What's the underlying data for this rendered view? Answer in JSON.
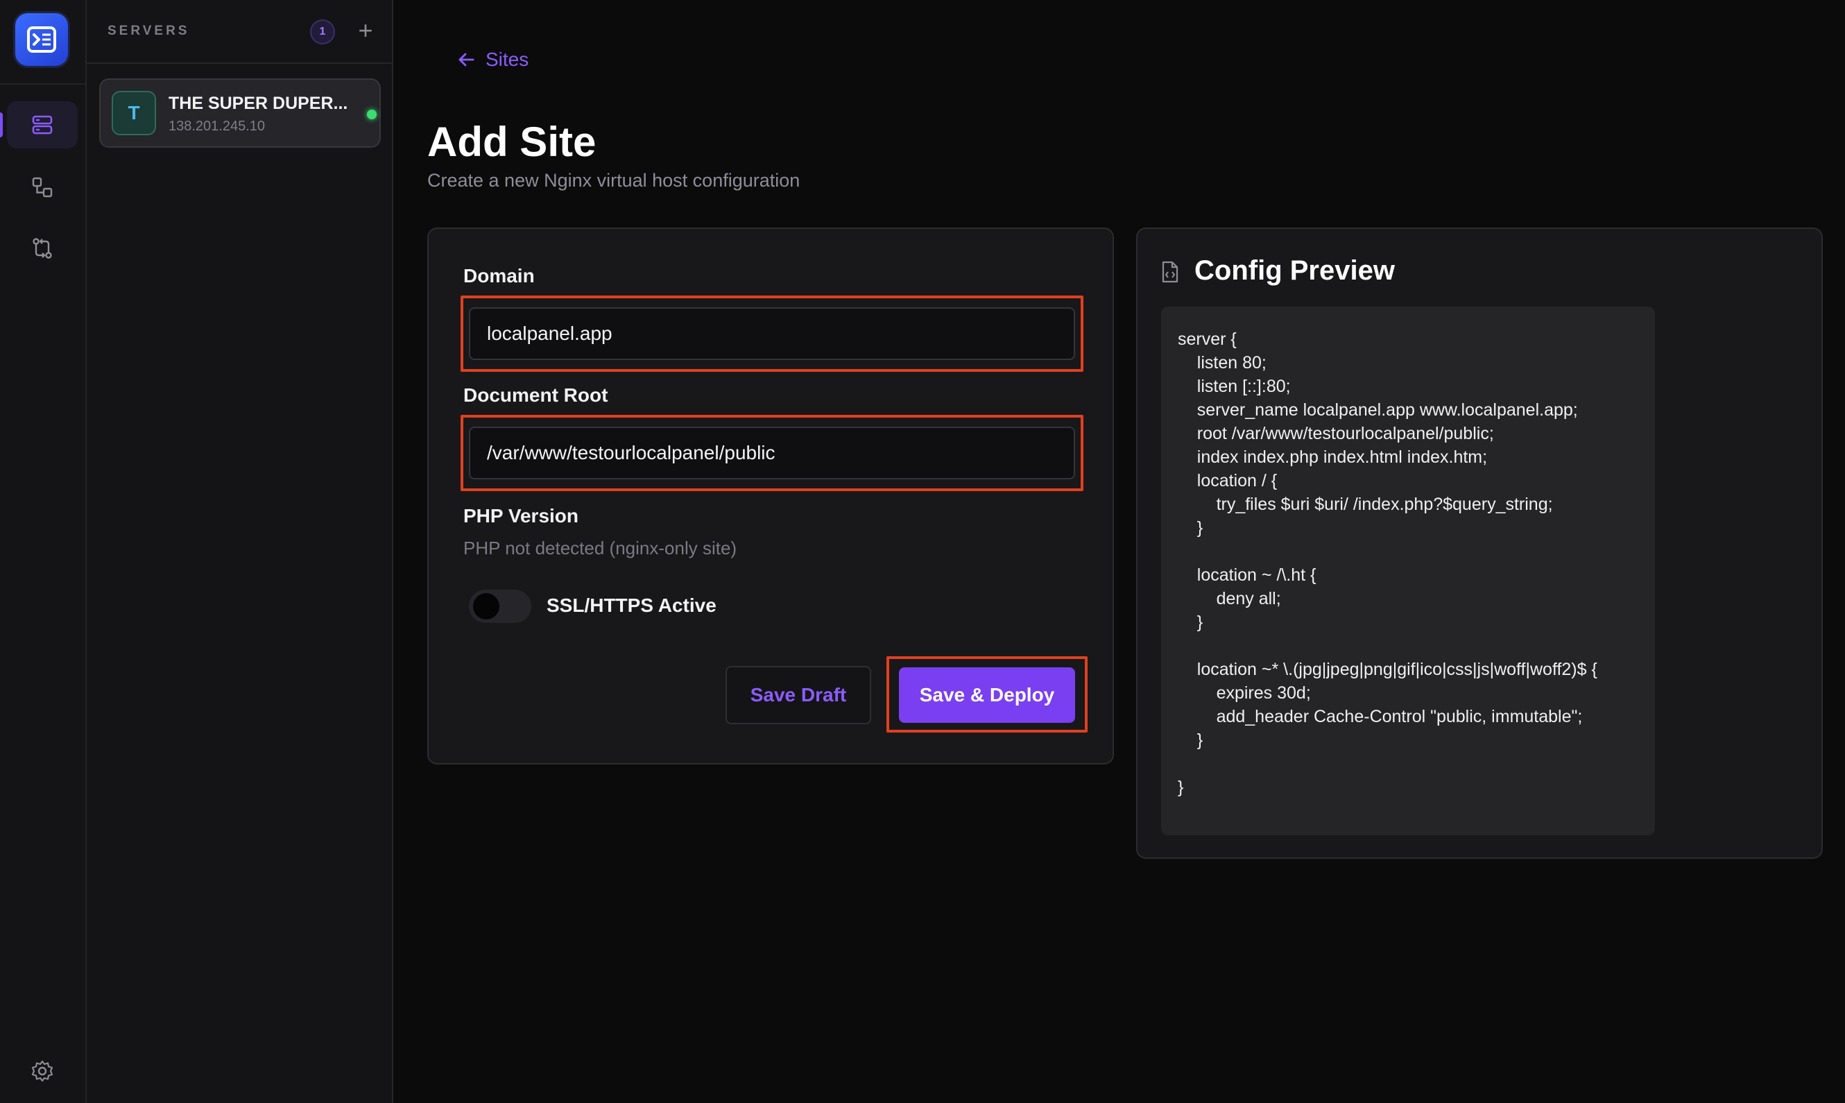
{
  "rail": {
    "logo_icon": "terminal-logo-icon",
    "items": [
      {
        "icon": "servers-icon",
        "active": true
      },
      {
        "icon": "connections-icon",
        "active": false
      },
      {
        "icon": "sync-icon",
        "active": false
      }
    ],
    "settings_icon": "gear-icon"
  },
  "servers": {
    "title": "SERVERS",
    "count": "1",
    "add_label": "+",
    "items": [
      {
        "avatar": "T",
        "name": "THE SUPER DUPER...",
        "ip": "138.201.245.10",
        "status": "online"
      }
    ]
  },
  "main": {
    "back_label": "Sites",
    "title": "Add Site",
    "subtitle": "Create a new Nginx virtual host configuration",
    "form": {
      "domain_label": "Domain",
      "domain_value": "localpanel.app",
      "docroot_label": "Document Root",
      "docroot_value": "/var/www/testourlocalpanel/public",
      "php_label": "PHP Version",
      "php_note": "PHP not detected (nginx-only site)",
      "ssl_label": "SSL/HTTPS Active",
      "ssl_enabled": false,
      "save_draft_label": "Save Draft",
      "save_deploy_label": "Save & Deploy"
    },
    "preview": {
      "title": "Config Preview",
      "code": "server {\n    listen 80;\n    listen [::]:80;\n    server_name localpanel.app www.localpanel.app;\n    root /var/www/testourlocalpanel/public;\n    index index.php index.html index.htm;\n    location / {\n        try_files $uri $uri/ /index.php?$query_string;\n    }\n\n    location ~ /\\.ht {\n        deny all;\n    }\n\n    location ~* \\.(jpg|jpeg|png|gif|ico|css|js|woff|woff2)$ {\n        expires 30d;\n        add_header Cache-Control \"public, immutable\";\n    }\n\n}"
    }
  },
  "colors": {
    "accent": "#7a3ff0",
    "highlight": "#e0401f",
    "status_online": "#3ddc6f"
  }
}
